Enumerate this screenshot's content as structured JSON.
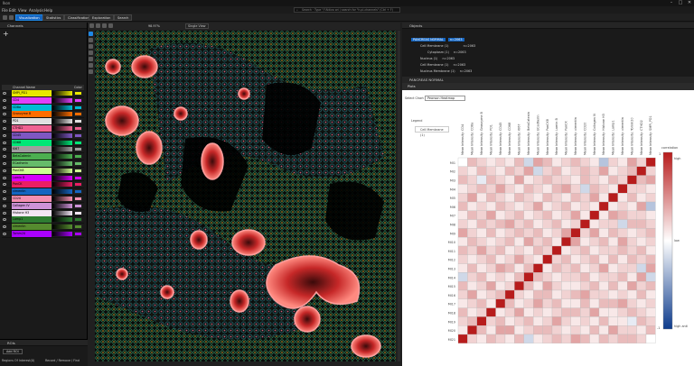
{
  "window": {
    "title": "Ikon",
    "controls": [
      "–",
      "□",
      "✕"
    ]
  },
  "menu": [
    "File",
    "Edit",
    "View",
    "Analysis",
    "Help"
  ],
  "search": {
    "placeholder": "Search · Type \"/\"Attivo ori / search for \"h.pl-channels\" (Ctrl + F)"
  },
  "tabs": [
    {
      "label": "Visualization",
      "active": true
    },
    {
      "label": "Statistics",
      "active": false
    },
    {
      "label": "Classification",
      "active": false
    },
    {
      "label": "Exploration",
      "active": false
    },
    {
      "label": "Search",
      "active": false
    }
  ],
  "channels_panel": {
    "title": "Channels",
    "columns": [
      "Channel Name",
      "Color"
    ],
    "items": [
      {
        "name": "SMPI_PD1",
        "color": "#e8e800"
      },
      {
        "name": "CD4",
        "color": "#e040fb"
      },
      {
        "name": "CD8a",
        "color": "#00bcd4"
      },
      {
        "name": "Granzyme B",
        "color": "#ff6d00"
      },
      {
        "name": "PD1",
        "color": "#e0e0e0"
      },
      {
        "name": "CTHD2",
        "color": "#f06292"
      },
      {
        "name": "CD45",
        "color": "#7e57c2"
      },
      {
        "name": "CD68",
        "color": "#00e676"
      },
      {
        "name": "KI67",
        "color": "#9e9e9e"
      },
      {
        "name": "BetaCatenin",
        "color": "#4caf50"
      },
      {
        "name": "ECadherin",
        "color": "#66bb6a"
      },
      {
        "name": "PanCK8",
        "color": "#ccff90"
      },
      {
        "name": "Lamin B",
        "color": "#d500f9"
      },
      {
        "name": "PanCK",
        "color": "#e91e63"
      },
      {
        "name": "vimentin",
        "color": "#1565c0"
      },
      {
        "name": "CD20",
        "color": "#f48fb1"
      },
      {
        "name": "Collagen IV",
        "color": "#ce93d8"
      },
      {
        "name": "Histone H3",
        "color": "#f3e5f5"
      },
      {
        "name": "Lamp1",
        "color": "#2e7d32"
      },
      {
        "name": "vimentin",
        "color": "#558b2f"
      },
      {
        "name": "Tomm20",
        "color": "#aa00ff"
      }
    ]
  },
  "viewer": {
    "zoom": "98.97%",
    "mode": "Single View"
  },
  "bottom_left": {
    "title": "ROIs",
    "add_button": "Add ROI",
    "regions_label": "Regions Of Interest(0)",
    "record_label": "Record / Remove / Find"
  },
  "objects_panel": {
    "title": "Objects",
    "root": "PANCREAS NORMAL",
    "root_count": "n=2063",
    "items": [
      {
        "label": "Cell Membrane (1)",
        "count": "n=2063"
      },
      {
        "label": "Cytoplasm (1)",
        "count": "n=2063"
      },
      {
        "label": "Nucleus (1)",
        "count": "n=2063"
      },
      {
        "label": "Cell Membrane (1)",
        "count": "n=2063"
      },
      {
        "label": "Nucleus Membrane (1)",
        "count": "n=2063"
      }
    ]
  },
  "stats_panel": {
    "title": "PANCREAS NORMAL",
    "subtab": "Plots",
    "select_chart_label": "Select Chart",
    "select_chart_value": "Pearson Heatmap",
    "legend_label": "Legend",
    "legend_entry": "Cell Membrane (1)"
  },
  "colorbar": {
    "title": "correlation",
    "high": "high",
    "low": "low",
    "high_anti": "high anti"
  },
  "chart_data": {
    "type": "heatmap",
    "rows": [
      "MI1",
      "MI2",
      "MI3",
      "MI4",
      "MI5",
      "MI6",
      "MI7",
      "MI8",
      "MI9",
      "MI10",
      "MI11",
      "MI12",
      "MI13",
      "MI14",
      "MI15",
      "MI16",
      "MI17",
      "MI18",
      "MI19",
      "MI20",
      "MI21"
    ],
    "cols": [
      "Mean Intensity: CD4",
      "Mean Intensity: CD8a",
      "Mean Intensity: Granzyme B",
      "Mean Intensity: PD1",
      "Mean Intensity: CD45",
      "Mean Intensity: CD68",
      "Mean Intensity: KI67",
      "Mean Intensity: BetaCatenin",
      "Mean Intensity: ECadherin",
      "Mean Intensity: PanCK8",
      "Mean Intensity: Lamin B",
      "Mean Intensity: PanCK",
      "Mean Intensity: vimentin",
      "Mean Intensity: CD20",
      "Mean Intensity: Collagen IV",
      "Mean Intensity: Histone H3",
      "Mean Intensity: Lamp1",
      "Mean Intensity: vimentin",
      "Mean Intensity: Tomm20",
      "Mean Intensity: CTHD2",
      "Mean Intensity: SMPI_PD1"
    ],
    "values": [
      [
        0,
        0.3,
        0.2,
        0.1,
        0.2,
        0.1,
        0.3,
        -0.2,
        0.4,
        0.3,
        0.1,
        0.2,
        0.3,
        0.2,
        0.1,
        -0.3,
        0.2,
        0.1,
        0.4,
        0.2,
        1
      ],
      [
        0.2,
        0.1,
        0.3,
        0.2,
        0.1,
        0.3,
        0.2,
        0.4,
        -0.2,
        0.2,
        0.3,
        0.1,
        0.2,
        0.3,
        0.2,
        0.4,
        0.1,
        0.2,
        0.3,
        1,
        0.2
      ],
      [
        0.3,
        0.2,
        -0.1,
        0.3,
        0.2,
        0.1,
        0.4,
        0.1,
        0.2,
        0.3,
        0.2,
        0.2,
        0.1,
        0.3,
        0.2,
        0.1,
        0.3,
        0.2,
        1,
        0.3,
        0.4
      ],
      [
        0.1,
        0.2,
        0.3,
        0.2,
        0.4,
        0.2,
        0.1,
        0.3,
        0.2,
        0.1,
        0.3,
        0.4,
        0.2,
        -0.2,
        0.3,
        0.2,
        0.1,
        1,
        0.2,
        0.2,
        0.1
      ],
      [
        0.2,
        0.4,
        0.1,
        0.3,
        0.2,
        0.1,
        0.3,
        0.2,
        0.1,
        0.3,
        0.2,
        0.1,
        0.3,
        0.2,
        0.4,
        0.1,
        1,
        0.1,
        0.3,
        0.1,
        0.2
      ],
      [
        0.3,
        0.1,
        0.2,
        0.1,
        0.3,
        0.2,
        0.1,
        0.2,
        0.4,
        0.1,
        0.2,
        0.3,
        0.1,
        0.2,
        0.1,
        1,
        0.1,
        0.2,
        0.1,
        0.4,
        -0.3
      ],
      [
        0.1,
        0.3,
        0.2,
        0.4,
        0.1,
        0.2,
        0.3,
        0.1,
        0.2,
        0.3,
        0.1,
        0.2,
        0.4,
        0.1,
        1,
        0.1,
        0.4,
        0.3,
        0.2,
        0.2,
        0.1
      ],
      [
        0.2,
        0.1,
        0.3,
        0.2,
        0.3,
        0.4,
        0.2,
        0.3,
        0.1,
        0.2,
        0.3,
        0.1,
        0.2,
        1,
        0.1,
        0.2,
        0.2,
        -0.2,
        0.3,
        0.3,
        0.2
      ],
      [
        0.4,
        0.2,
        0.1,
        0.3,
        0.1,
        0.2,
        0.3,
        0.2,
        0.3,
        0.1,
        0.2,
        0.4,
        1,
        0.2,
        0.4,
        0.1,
        0.3,
        0.2,
        0.1,
        0.2,
        0.3
      ],
      [
        0.1,
        0.3,
        0.2,
        0.1,
        0.2,
        0.3,
        0.1,
        0.4,
        0.2,
        0.3,
        0.1,
        1,
        0.4,
        0.1,
        0.2,
        0.3,
        0.1,
        0.4,
        0.2,
        0.1,
        0.2
      ],
      [
        0.3,
        0.2,
        0.4,
        0.2,
        0.3,
        0.1,
        0.2,
        0.1,
        0.3,
        0.2,
        1,
        0.1,
        0.2,
        0.3,
        0.1,
        0.2,
        0.2,
        0.3,
        0.2,
        0.3,
        0.1
      ],
      [
        0.2,
        0.1,
        0.2,
        0.3,
        0.1,
        0.2,
        0.4,
        0.2,
        0.1,
        1,
        0.2,
        0.3,
        0.1,
        0.2,
        0.3,
        0.1,
        0.3,
        0.1,
        0.3,
        0.2,
        0.3
      ],
      [
        0.1,
        0.3,
        0.1,
        0.2,
        0.4,
        0.3,
        0.1,
        0.3,
        1,
        0.1,
        0.3,
        0.2,
        0.3,
        0.1,
        0.2,
        0.4,
        0.1,
        0.2,
        0.2,
        -0.2,
        0.4
      ],
      [
        -0.2,
        0.2,
        0.3,
        0.1,
        0.2,
        0.1,
        0.3,
        1,
        0.3,
        0.2,
        0.1,
        0.2,
        0.2,
        0.3,
        0.1,
        0.2,
        0.2,
        0.3,
        0.1,
        0.4,
        -0.2
      ],
      [
        0.3,
        0.1,
        0.2,
        0.4,
        0.1,
        0.2,
        1,
        0.3,
        0.1,
        0.4,
        0.2,
        0.1,
        0.1,
        0.2,
        0.3,
        0.1,
        0.3,
        0.1,
        0.4,
        0.2,
        0.3
      ],
      [
        0.2,
        0.4,
        0.1,
        0.2,
        0.3,
        1,
        0.2,
        0.1,
        0.3,
        0.3,
        0.1,
        0.2,
        0.3,
        0.4,
        0.2,
        0.2,
        0.1,
        0.2,
        0.1,
        0.3,
        0.1
      ],
      [
        0.1,
        0.2,
        0.3,
        0.1,
        1,
        0.3,
        0.1,
        0.2,
        0.4,
        0.2,
        0.3,
        0.1,
        0.1,
        0.3,
        0.1,
        0.3,
        0.3,
        0.4,
        0.2,
        0.1,
        0.2
      ],
      [
        0.3,
        0.1,
        0.2,
        1,
        0.1,
        0.2,
        0.4,
        0.1,
        0.2,
        0.1,
        0.2,
        0.3,
        0.3,
        0.2,
        0.4,
        0.1,
        0.1,
        0.2,
        0.3,
        0.2,
        0.1
      ],
      [
        0.2,
        0.3,
        1,
        0.2,
        0.3,
        0.1,
        0.2,
        0.3,
        0.1,
        0.2,
        0.4,
        0.2,
        0.1,
        0.2,
        0.1,
        0.3,
        0.1,
        0.1,
        -0.1,
        0.3,
        0.2
      ],
      [
        0.1,
        1,
        0.3,
        0.1,
        0.4,
        0.4,
        0.1,
        0.2,
        0.3,
        0.3,
        0.2,
        0.1,
        0.2,
        0.1,
        0.3,
        0.1,
        0.4,
        0.2,
        0.2,
        0.1,
        0.3
      ],
      [
        1,
        0.2,
        0.1,
        0.3,
        0.2,
        0.1,
        0.3,
        -0.2,
        0.1,
        0.2,
        0.3,
        0.2,
        0.4,
        0.3,
        0.1,
        0.3,
        0.2,
        0.3,
        0.3,
        0.2,
        0
      ]
    ],
    "range": [
      -1,
      1
    ]
  },
  "colors": {
    "accent": "#1565c0",
    "high": "#b71c1c",
    "low": "#0d3b8c"
  }
}
